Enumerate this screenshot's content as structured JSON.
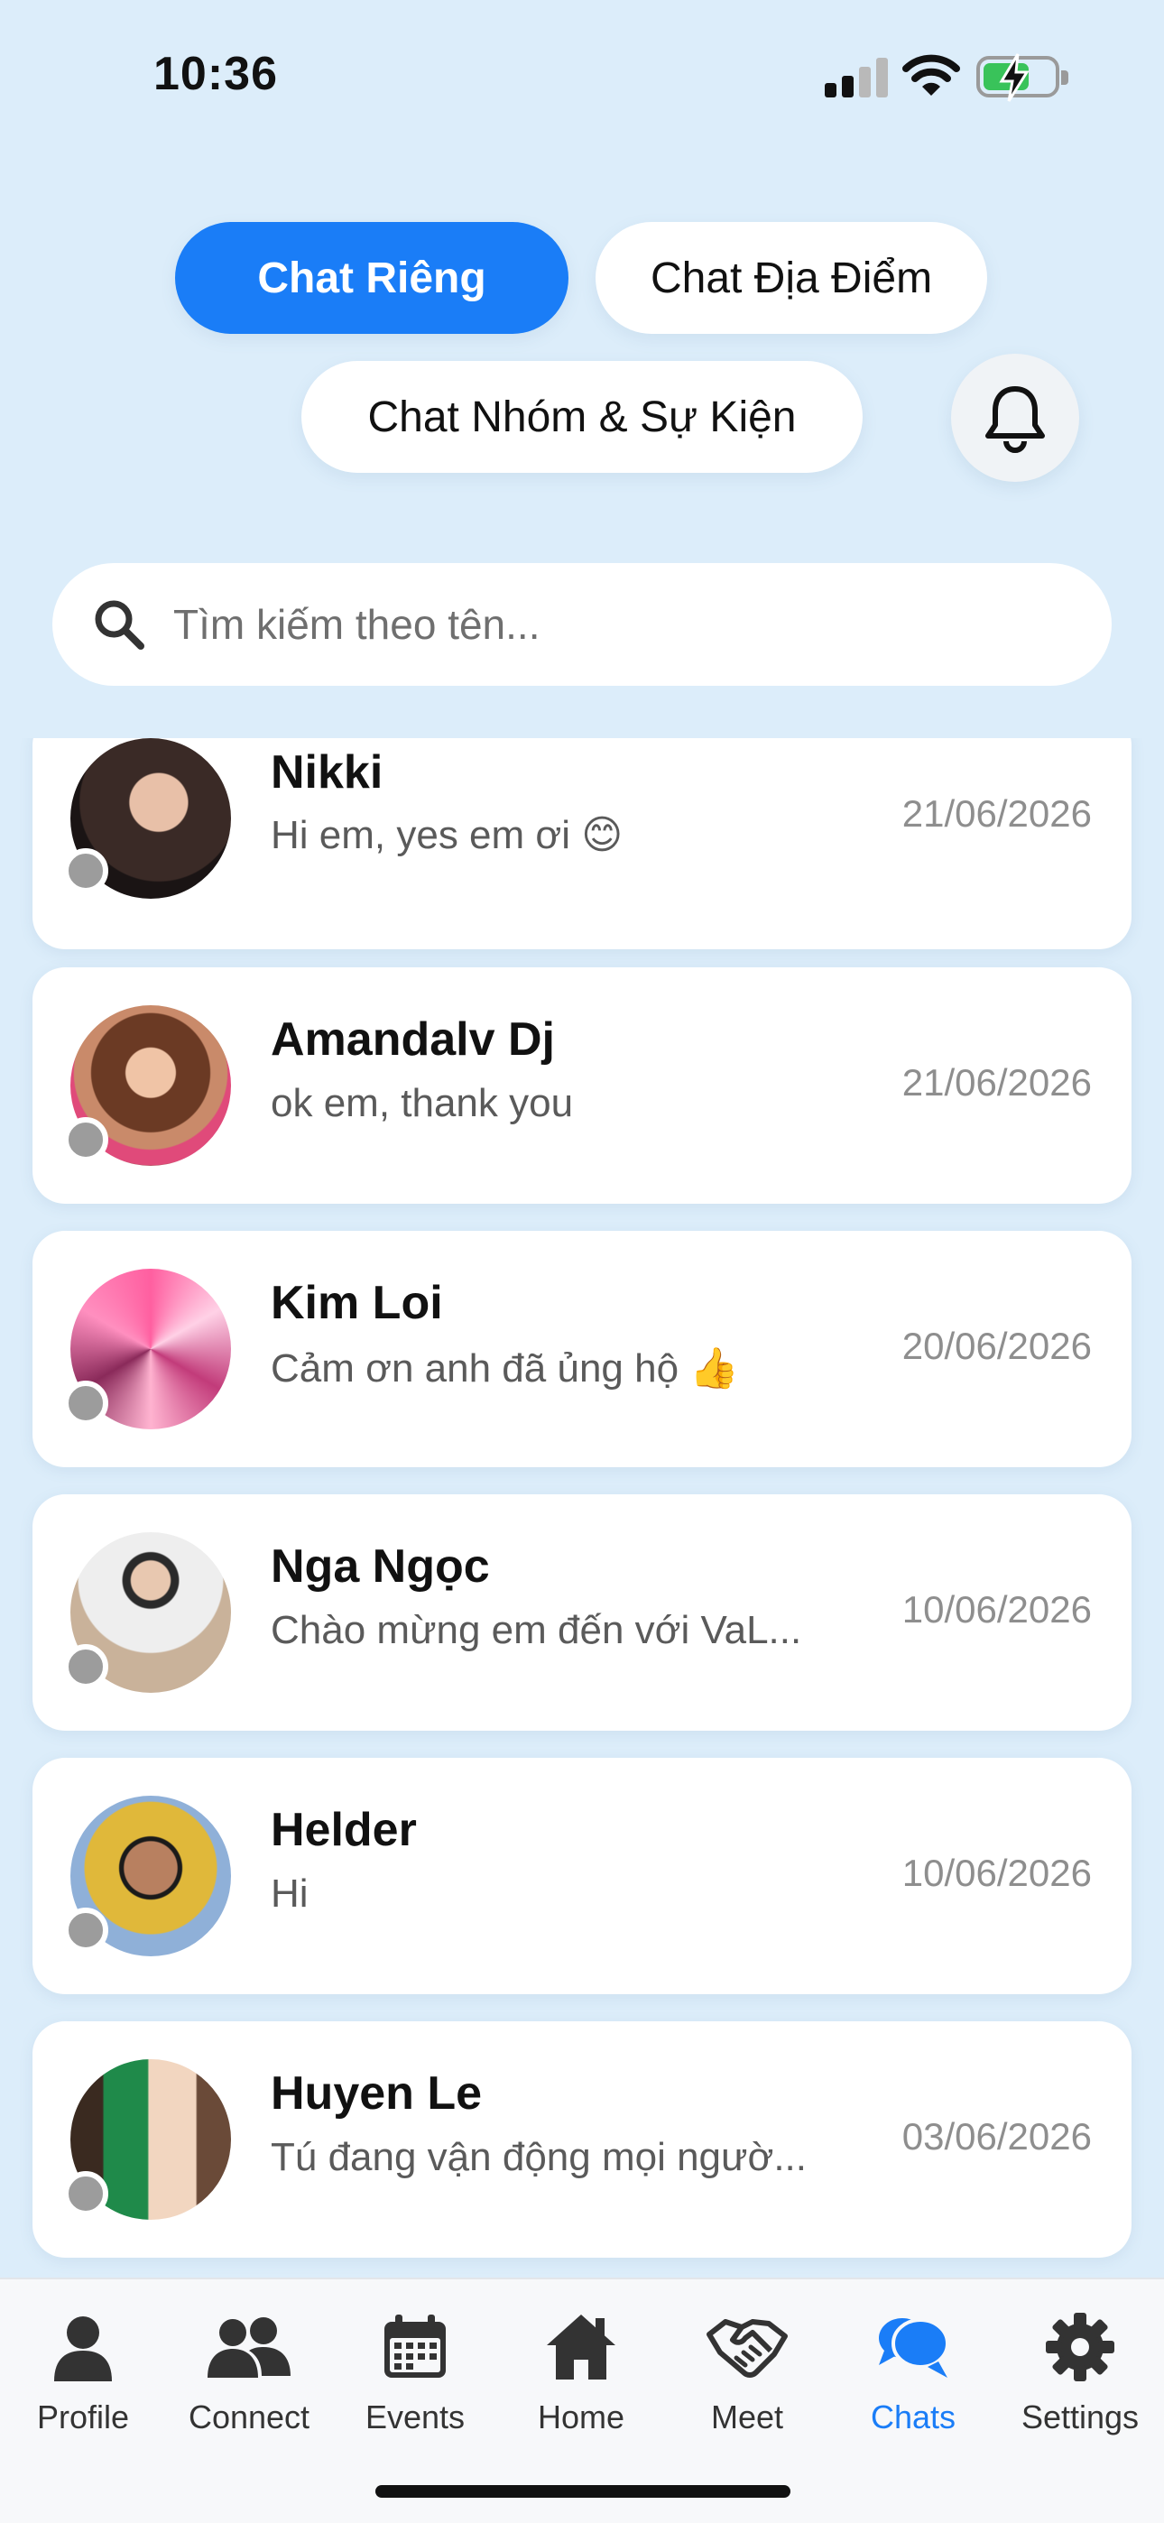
{
  "status_bar": {
    "time": "10:36"
  },
  "tabs": [
    {
      "label": "Chat Riêng",
      "active": true
    },
    {
      "label": "Chat Địa Điểm",
      "active": false
    },
    {
      "label": "Chat Nhóm & Sự Kiện",
      "active": false
    }
  ],
  "notification_icon": "bell-icon",
  "search": {
    "placeholder": "Tìm kiếm theo tên..."
  },
  "chats": [
    {
      "name": "Nikki",
      "message": "Hi em, yes em ơi 😊",
      "date": "21/06/2026",
      "online": false
    },
    {
      "name": "Amandalv Dj",
      "message": "ok em, thank you",
      "date": "21/06/2026",
      "online": false
    },
    {
      "name": "Kim Loi",
      "message": "Cảm ơn anh đã ủng hộ 👍",
      "date": "20/06/2026",
      "online": false
    },
    {
      "name": "Nga Ngọc",
      "message": "Chào mừng em đến với VaL...",
      "date": "10/06/2026",
      "online": false
    },
    {
      "name": "Helder",
      "message": "Hi",
      "date": "10/06/2026",
      "online": false
    },
    {
      "name": "Huyen Le",
      "message": "Tú đang vận động mọi ngườ...",
      "date": "03/06/2026",
      "online": false
    }
  ],
  "nav": [
    {
      "label": "Profile",
      "icon": "person-icon",
      "active": false
    },
    {
      "label": "Connect",
      "icon": "people-icon",
      "active": false
    },
    {
      "label": "Events",
      "icon": "calendar-icon",
      "active": false
    },
    {
      "label": "Home",
      "icon": "home-icon",
      "active": false
    },
    {
      "label": "Meet",
      "icon": "handshake-icon",
      "active": false
    },
    {
      "label": "Chats",
      "icon": "chat-bubbles-icon",
      "active": true
    },
    {
      "label": "Settings",
      "icon": "gear-icon",
      "active": false
    }
  ],
  "colors": {
    "accent": "#1a7df7",
    "background": "#dcedfa",
    "presence": "#9c9c9c"
  }
}
